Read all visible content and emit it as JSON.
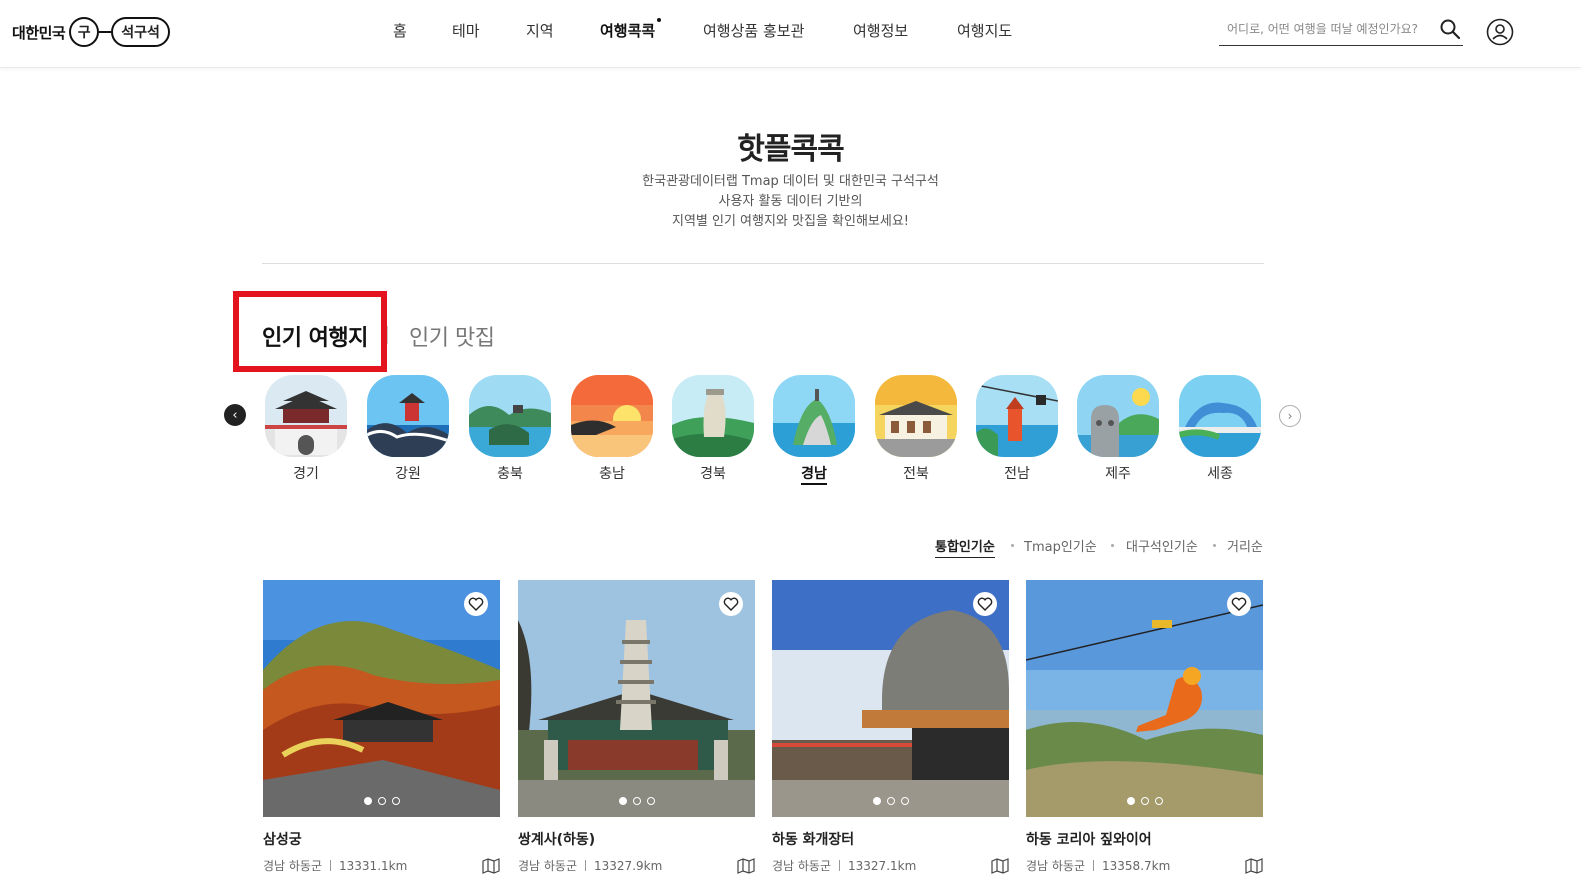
{
  "header": {
    "logo_text": "대한민국",
    "logo_circle": "구",
    "logo_pill": "석구석",
    "nav": [
      "홈",
      "테마",
      "지역",
      "여행콕콕",
      "여행상품 홍보관",
      "여행정보",
      "여행지도"
    ],
    "search_placeholder": "어디로, 어떤 여행을 떠날 예정인가요?"
  },
  "hero": {
    "title": "핫플콕콕",
    "desc_lines": [
      "한국관광데이터랩 Tmap 데이터 및 대한민국 구석구석",
      "사용자 활동 데이터 기반의",
      "지역별 인기 여행지와 맛집을 확인해보세요!"
    ]
  },
  "tabs": [
    "인기 여행지",
    "인기 맛집"
  ],
  "regions": [
    "경기",
    "강원",
    "충북",
    "충남",
    "경북",
    "경남",
    "전북",
    "전남",
    "제주",
    "세종"
  ],
  "active_region": "경남",
  "sort": [
    "통합인기순",
    "Tmap인기순",
    "대구석인기순",
    "거리순"
  ],
  "cards": [
    {
      "title": "삼성궁",
      "region": "경남 하동군",
      "distance": "13331.1km"
    },
    {
      "title": "쌍계사(하동)",
      "region": "경남 하동군",
      "distance": "13327.9km"
    },
    {
      "title": "하동 화개장터",
      "region": "경남 하동군",
      "distance": "13327.1km"
    },
    {
      "title": "하동 코리아 짚와이어",
      "region": "경남 하동군",
      "distance": "13358.7km"
    }
  ],
  "colors": {
    "highlight": "#e4141e",
    "text": "#222222"
  }
}
